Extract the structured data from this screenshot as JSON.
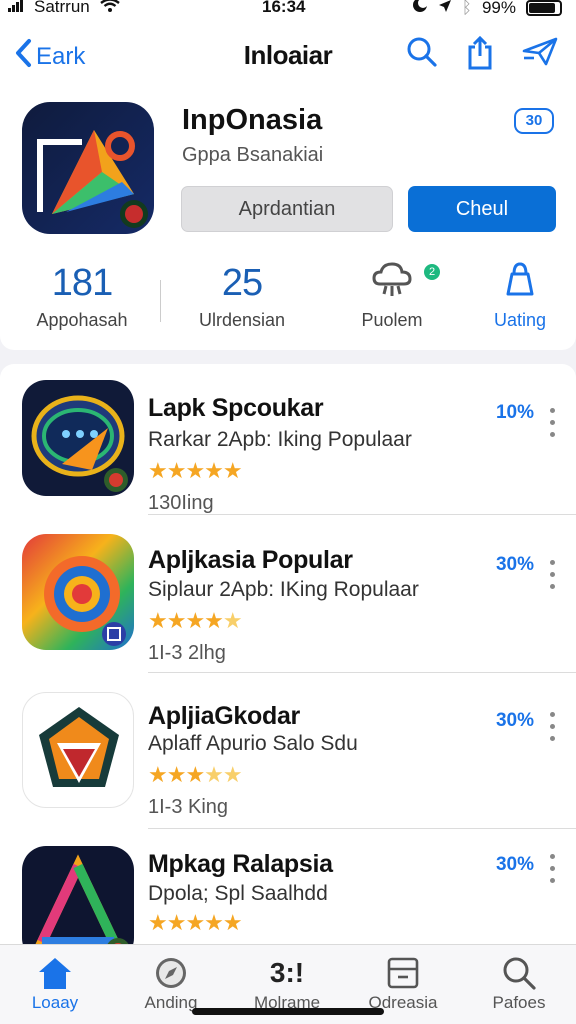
{
  "status": {
    "carrier": "Satrrun",
    "time": "16:34",
    "battery": "99%"
  },
  "nav": {
    "back": "Eark",
    "title": "Inloaiar"
  },
  "app": {
    "name": "InpOnasia",
    "developer": "Gppa Bsanakiai",
    "badge": "30",
    "button_secondary": "Aprdantian",
    "button_primary": "Cheul"
  },
  "stats": [
    {
      "value": "181",
      "label": "Appohasah"
    },
    {
      "value": "25",
      "label": "Ulrdensian"
    },
    {
      "label": "Puolem",
      "badge": "2"
    },
    {
      "label": "Uating"
    }
  ],
  "apps": [
    {
      "title": "Lapk Spcoukar",
      "subtitle": "Rarkar 2Apb: Iking Populaar",
      "meta": "130Iing",
      "percent": "10%",
      "rating": 5
    },
    {
      "title": "Apljkasia Popular",
      "subtitle": "Siplaur 2Apb: IKing Ropulaar",
      "meta": "1I-3 2lhg",
      "percent": "30%",
      "rating": 4.5
    },
    {
      "title": "ApljiaGkodar",
      "subtitle": "Aplaff Apurio Salo Sdu",
      "meta": "1I-3 King",
      "percent": "30%",
      "rating": 3.5
    },
    {
      "title": "Mpkag Ralapsia",
      "subtitle": "Dpola; Spl Saalhdd",
      "meta": "",
      "percent": "30%",
      "rating": 5
    }
  ],
  "tabs": [
    {
      "label": "Loaay",
      "icon": "home-icon",
      "active": true
    },
    {
      "label": "Anding",
      "icon": "compass-icon"
    },
    {
      "label": "Molrame",
      "icon": "apps-icon",
      "glyph": "3:!"
    },
    {
      "label": "Odreasia",
      "icon": "inbox-icon"
    },
    {
      "label": "Pafoes",
      "icon": "search-icon"
    }
  ],
  "colors": {
    "accent": "#1a73e8",
    "primary_button": "#0a6fd6",
    "star": "#f5a623"
  }
}
